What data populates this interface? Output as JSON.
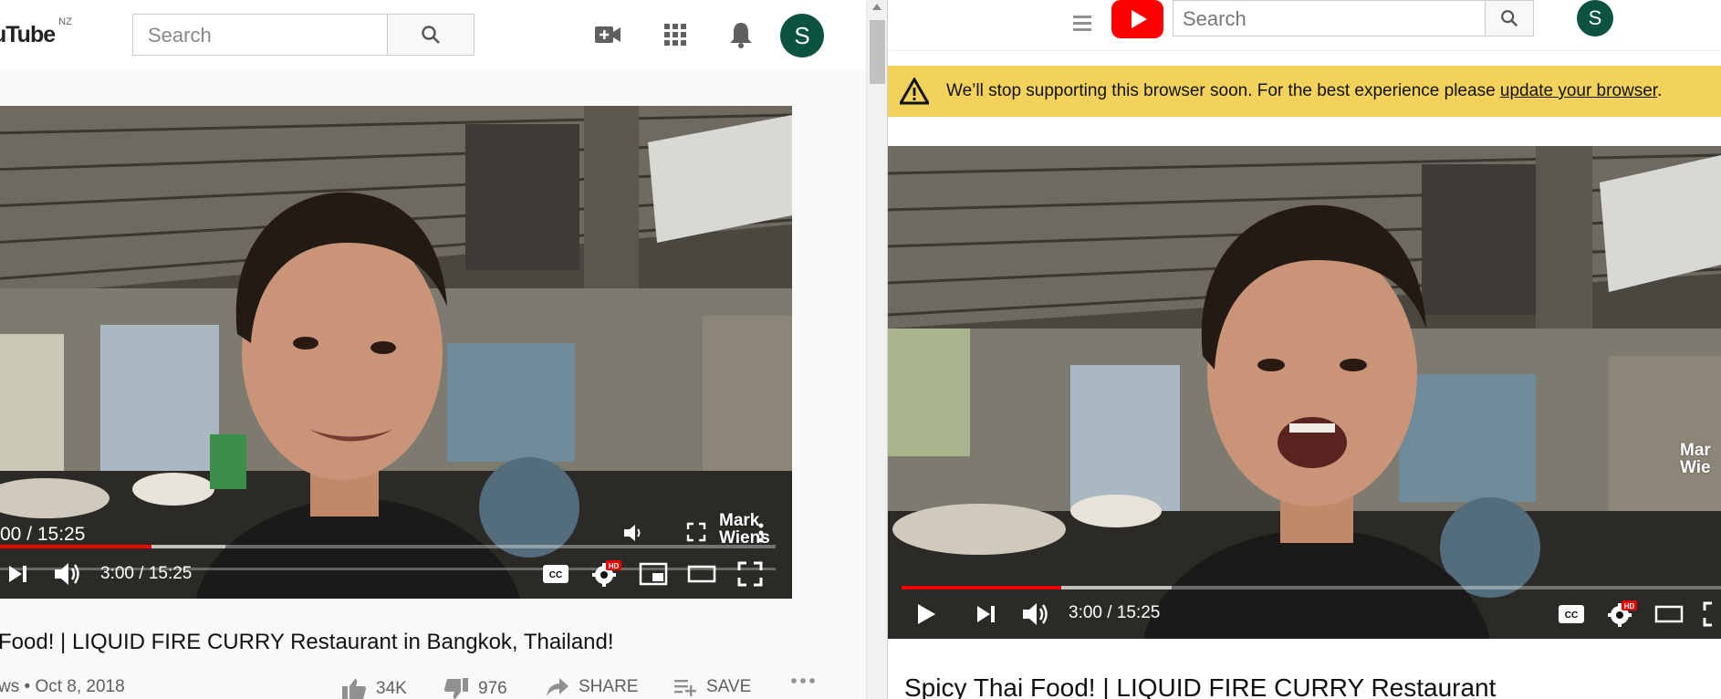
{
  "left": {
    "logo_text": "uTube",
    "logo_region": "NZ",
    "search_placeholder": "Search",
    "avatar_letter": "S",
    "icons": [
      "create-video-icon",
      "apps-grid-icon",
      "notifications-bell-icon"
    ],
    "video": {
      "overlay_time": "00 / 15:25",
      "time": "3:00 / 15:25",
      "watermark_line1": "Mark",
      "watermark_line2": "Wiens",
      "progress_fraction": 0.195,
      "buffered_fraction": 0.29
    },
    "title": "Food! | LIQUID FIRE CURRY Restaurant in Bangkok, Thailand!",
    "meta_prefix": "ws",
    "date": "Oct 8, 2018",
    "likes": "34K",
    "dislikes": "976",
    "share_label": "SHARE",
    "save_label": "SAVE"
  },
  "right": {
    "search_placeholder": "Search",
    "avatar_letter": "S",
    "banner": {
      "text": "We’ll stop supporting this browser soon. For the best experience please ",
      "link": "update your browser",
      "suffix": "."
    },
    "video": {
      "time": "3:00 / 15:25",
      "watermark_line1": "Mar",
      "watermark_line2": "Wie",
      "progress_fraction": 0.195,
      "buffered_fraction": 0.33
    },
    "title": "Spicy Thai Food! | LIQUID FIRE CURRY Restaurant"
  },
  "colors": {
    "accent_red": "#ff0000",
    "progress_red": "#e00000",
    "avatar_green": "#0b5340",
    "banner_yellow": "#f2d25a"
  }
}
